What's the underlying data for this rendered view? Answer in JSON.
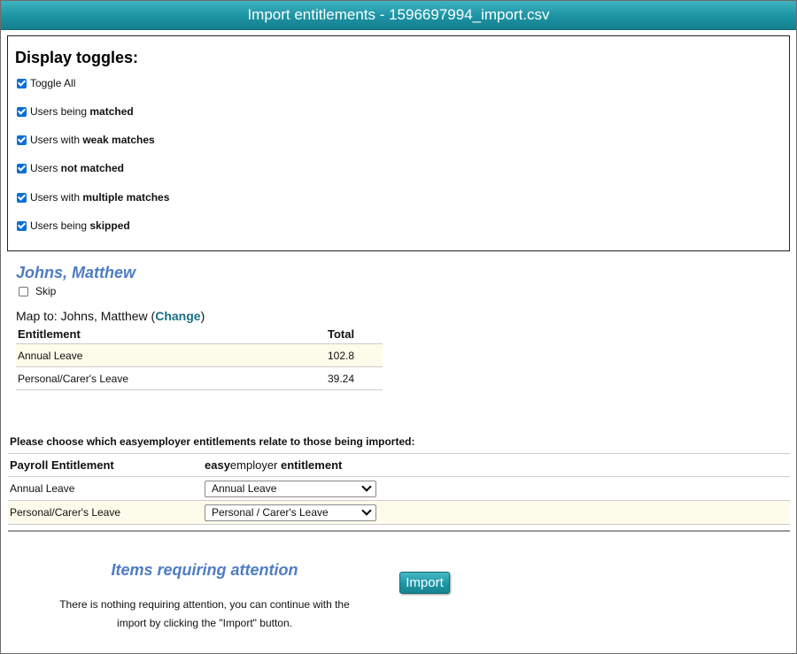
{
  "window": {
    "title": "Import entitlements - 1596697994_import.csv"
  },
  "toggles": {
    "heading": "Display toggles:",
    "items": [
      {
        "prefix": "Toggle All",
        "bold": "",
        "checked": true
      },
      {
        "prefix": "Users being ",
        "bold": "matched",
        "checked": true
      },
      {
        "prefix": "Users with ",
        "bold": "weak matches",
        "checked": true
      },
      {
        "prefix": "Users ",
        "bold": "not matched",
        "checked": true
      },
      {
        "prefix": "Users with ",
        "bold": "multiple matches",
        "checked": true
      },
      {
        "prefix": "Users being ",
        "bold": "skipped",
        "checked": true
      }
    ]
  },
  "person": {
    "name": "Johns, Matthew",
    "skip_label": "Skip",
    "skip_checked": false,
    "map_to_prefix": "Map to: ",
    "map_to_name": "Johns, Matthew",
    "change_label": "Change",
    "table": {
      "headers": [
        "Entitlement",
        "Total"
      ],
      "rows": [
        [
          "Annual Leave",
          "102.8"
        ],
        [
          "Personal/Carer's Leave",
          "39.24"
        ]
      ]
    }
  },
  "mapping": {
    "instruction": "Please choose which easyemployer entitlements relate to those being imported:",
    "header_payroll": "Payroll Entitlement",
    "header_ee_bold1": "easy",
    "header_ee_light": "employer",
    "header_ee_bold2": " entitlement",
    "rows": [
      {
        "payroll": "Annual Leave",
        "selected": "Annual Leave"
      },
      {
        "payroll": "Personal/Carer's Leave",
        "selected": "Personal / Carer's Leave"
      }
    ]
  },
  "attention": {
    "title": "Items requiring attention",
    "line1": "There is nothing requiring attention, you can continue with the",
    "line2": "import by clicking the \"Import\" button."
  },
  "actions": {
    "import_label": "Import"
  },
  "colors": {
    "accent": "#1b93a3",
    "heading_blue": "#4f7cc4",
    "row_alt": "#fdfbea"
  }
}
